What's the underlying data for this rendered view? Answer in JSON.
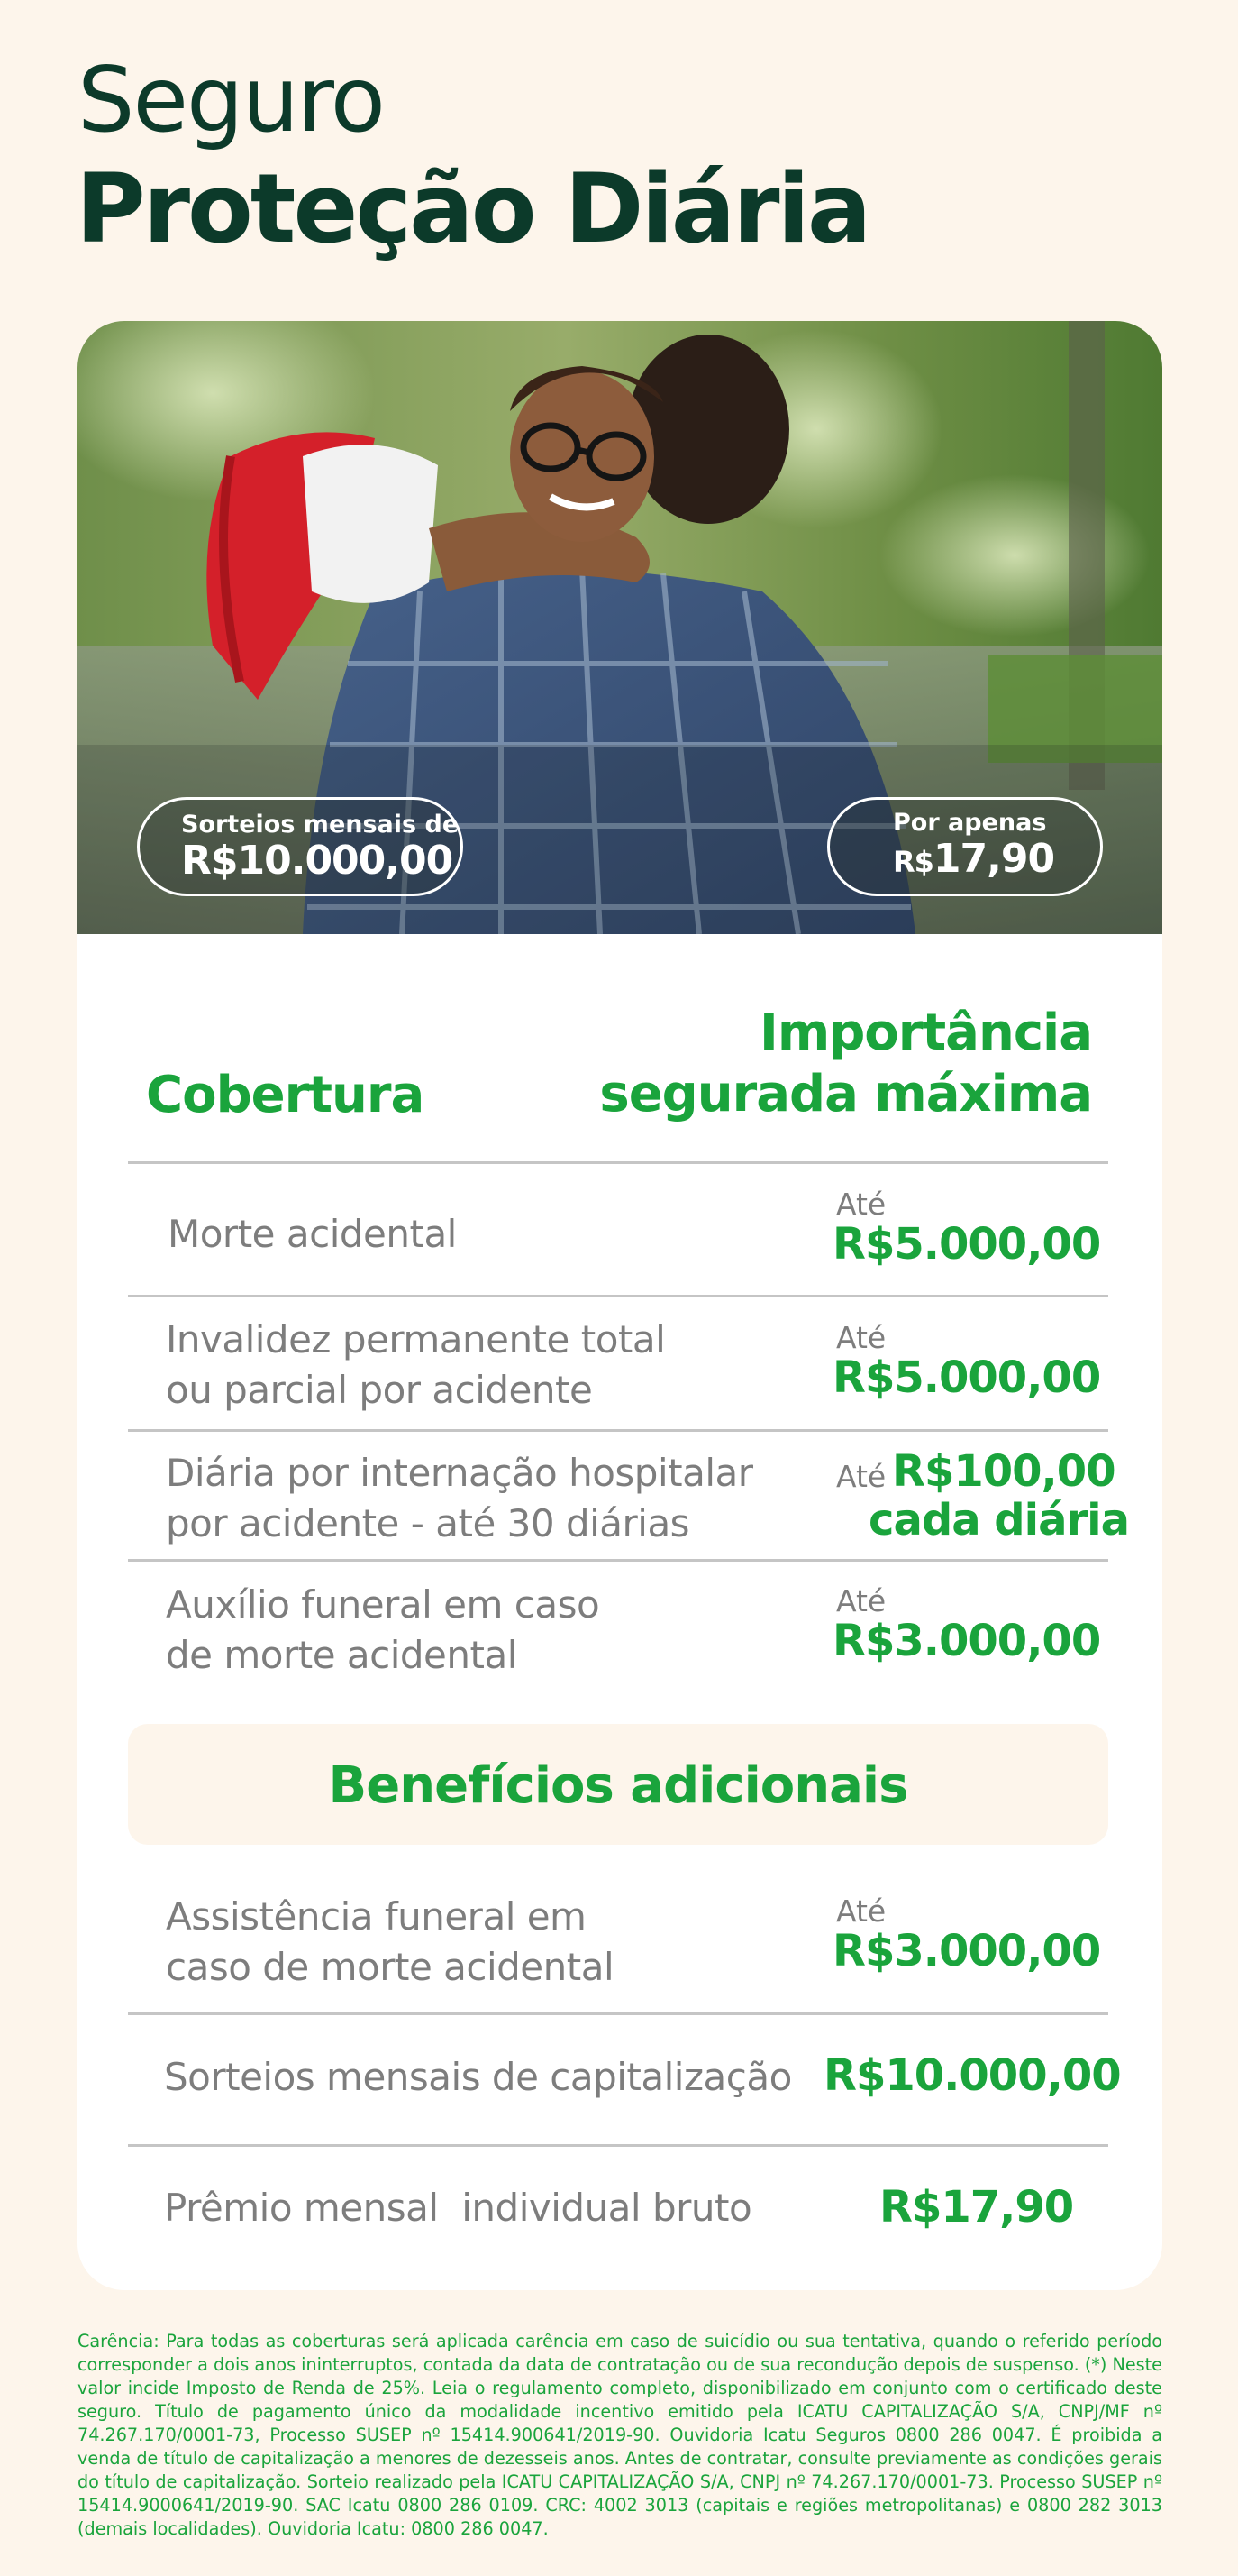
{
  "header": {
    "title_line1": "Seguro",
    "title_line2": "Proteção Diária"
  },
  "photo": {
    "alt": "",
    "pill_left": {
      "small": "Sorteios mensais de",
      "big": "R$10.000,00"
    },
    "pill_right": {
      "small": "Por apenas",
      "currency": "R$",
      "big": "17,90"
    }
  },
  "table": {
    "col1": "Cobertura",
    "col2": "Importância segurada máxima",
    "col2_line1": "Importância",
    "col2_line2": "segurada máxima",
    "rows": [
      {
        "label1": "Morte acidental",
        "label2": "",
        "prefix": "Até",
        "value": "R$5.000,00"
      },
      {
        "label1": "Invalidez permanente total",
        "label2": "ou parcial por acidente",
        "prefix": "Até",
        "value": "R$5.000,00"
      },
      {
        "label1": "Diária por internação hospitalar",
        "label2": "por acidente - até 30 diárias",
        "prefix": "Até",
        "value": "R$100,00",
        "value2": "cada diária"
      },
      {
        "label1": "Auxílio funeral em caso",
        "label2": "de morte acidental",
        "prefix": "Até",
        "value": "R$3.000,00"
      }
    ]
  },
  "benefits": {
    "title": "Benefícios adicionais",
    "rows": [
      {
        "label1": "Assistência funeral em",
        "label2": "caso de morte acidental",
        "prefix": "Até",
        "value": "R$3.000,00"
      },
      {
        "label1": "Sorteios mensais de capitalização",
        "value": "R$10.000,00"
      },
      {
        "label1": "Prêmio mensal  individual bruto",
        "value": "R$17,90"
      }
    ]
  },
  "disclaimer": "Carência: Para todas as coberturas será aplicada carência em caso de suicídio ou sua tentativa, quando o referido período corresponder a dois anos ininterruptos, contada da data de contratação ou de sua recondução depois de suspenso. (*) Neste valor incide Imposto de Renda de 25%. Leia o regulamento completo, disponibilizado em conjunto com o certificado deste seguro. Título de pagamento único da modalidade incentivo emitido pela ICATU CAPITALIZAÇÃO S/A, CNPJ/MF nº 74.267.170/0001-73, Processo SUSEP nº 15414.900641/2019-90. Ouvidoria Icatu Seguros 0800 286 0047. É proibida a venda de título de capitalização a menores de dezesseis anos. Antes de contratar, consulte previamente as condições gerais do título de capitalização. Sorteio realizado pela ICATU CAPITALIZAÇÃO S/A, CNPJ nº 74.267.170/0001-73. Processo SUSEP nº 15414.9000641/2019-90. SAC Icatu 0800 286 0109. CRC: 4002 3013 (capitais e regiões metropolitanas) e 0800 282 3013 (demais localidades). Ouvidoria Icatu: 0800 286 0047."
}
